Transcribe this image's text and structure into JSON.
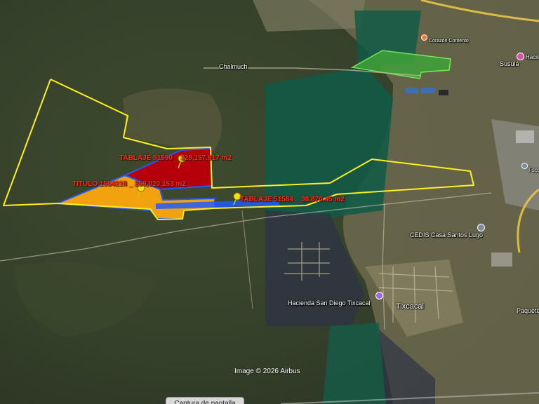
{
  "map": {
    "labels": {
      "chalmuch": "Chalmuch",
      "corazon": "Corazón Contento",
      "susula": "Susulá",
      "hacienda_top": "Hacienda",
      "cedis": "CEDIS Casa Santos Lugo",
      "hacienda_san_diego": "Hacienda San Diego Tixcacal",
      "tixcacal": "Tixcacal",
      "paquete": "Paquete",
      "fsco": "Fsco"
    },
    "parcels": {
      "tablaje_51590": "TABLAJE 51590 _ 328,157.817 m2",
      "titulo": "TITULO 1554218 _ 259,020.153 m2",
      "tablaje_51584": "TABLAJE 51584 _ 38,870.45 m2"
    },
    "attribution": "Image © 2026 Airbus",
    "capture_button": "Captura de pantalla",
    "colors": {
      "boundary": "#ffef1f",
      "parcel_red": "#b5000c",
      "parcel_orange": "#f2a20f",
      "parcel_blue": "#1f5bff",
      "parcel_label": "#ff2a1a",
      "pin": "#f7e012"
    }
  }
}
